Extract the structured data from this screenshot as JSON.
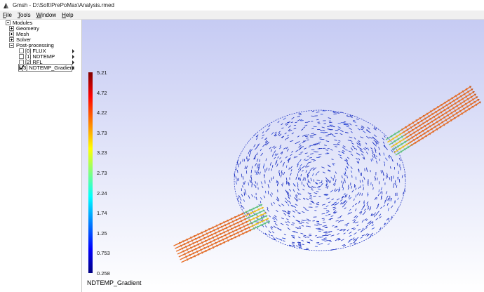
{
  "window": {
    "title": "Gmsh - D:\\Soft\\PrePoMax\\Analysis.rmed"
  },
  "menu": [
    "File",
    "Tools",
    "Window",
    "Help"
  ],
  "tree": {
    "modules": "Modules",
    "geometry": "Geometry",
    "mesh": "Mesh",
    "solver": "Solver",
    "post": "Post-processing",
    "views": [
      {
        "label": "[0] FLUX",
        "visible": false
      },
      {
        "label": "[1] NDTEMP",
        "visible": false
      },
      {
        "label": "[2] RFL",
        "visible": false
      },
      {
        "label": "[3] NDTEMP_Gradient",
        "visible": true
      }
    ]
  },
  "scale": {
    "name": "NDTEMP_Gradient",
    "ticks": [
      "5.21",
      "4.72",
      "4.22",
      "3.73",
      "3.23",
      "2.73",
      "2.24",
      "1.74",
      "1.25",
      "0.753",
      "0.258"
    ]
  },
  "colors": {
    "menubar": "#f0f0f0",
    "viewport_top": "#c6cbf3",
    "arrow_high": "#e8702a",
    "arrow_low": "#1a2fc0"
  }
}
